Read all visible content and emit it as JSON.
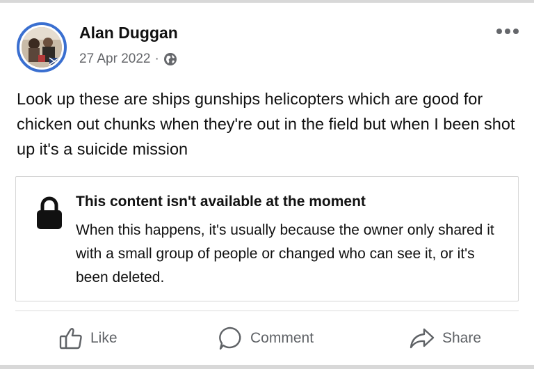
{
  "post": {
    "author": "Alan Duggan",
    "date": "27 Apr 2022",
    "separator": "·",
    "privacy_icon": "globe-icon",
    "more_icon": "more-options-icon",
    "text": "Look up these are ships gunships helicopters which are good for chicken out chunks when they're out in the field but when I been shot up it's a suicide mission"
  },
  "shared_content": {
    "icon": "lock-icon",
    "title": "This content isn't available at the moment",
    "body": "When this happens, it's usually because the owner only shared it with a small group of people or changed who can see it, or it's been deleted."
  },
  "actions": {
    "like_label": "Like",
    "comment_label": "Comment",
    "share_label": "Share"
  },
  "colors": {
    "avatar_ring": "#3a6fd0",
    "secondary_text": "#65676b",
    "icon_gray": "#5f6266"
  }
}
